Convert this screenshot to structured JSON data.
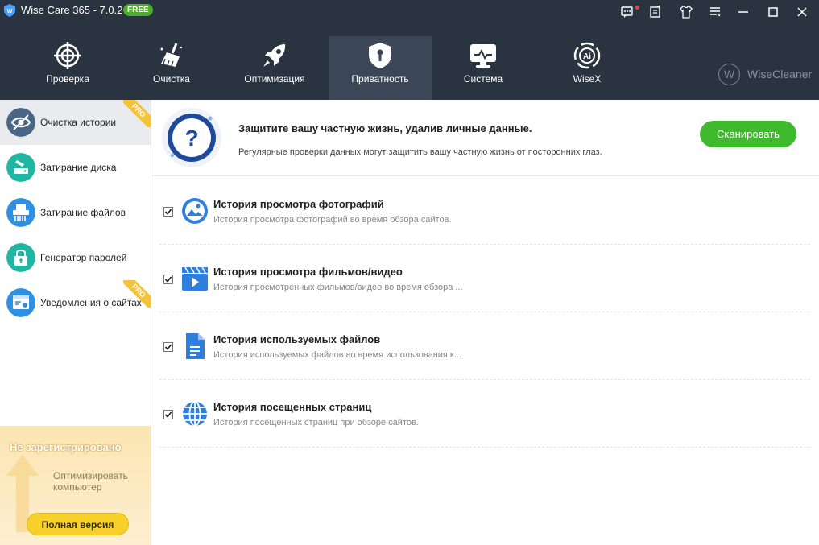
{
  "window": {
    "title": "Wise Care 365 - 7.0.2",
    "badge": "FREE"
  },
  "nav": {
    "tabs": [
      {
        "label": "Проверка",
        "icon": "crosshair-icon"
      },
      {
        "label": "Очистка",
        "icon": "broom-icon"
      },
      {
        "label": "Оптимизация",
        "icon": "rocket-icon"
      },
      {
        "label": "Приватность",
        "icon": "shield-lock-icon"
      },
      {
        "label": "Система",
        "icon": "monitor-icon"
      },
      {
        "label": "WiseX",
        "icon": "ai-icon"
      }
    ],
    "active_tab": "Приватность",
    "brand": "WiseCleaner",
    "brand_mark": "W"
  },
  "sidebar": {
    "items": [
      {
        "label": "Очистка истории",
        "badge": "PRO"
      },
      {
        "label": "Затирание диска"
      },
      {
        "label": "Затирание файлов"
      },
      {
        "label": "Генератор паролей"
      },
      {
        "label": "Уведомления о сайтах",
        "badge": "PRO"
      }
    ],
    "promo": {
      "title": "Не зарегистрировано",
      "text": "Оптимизировать компьютер",
      "button": "Полная версия"
    }
  },
  "main": {
    "banner": {
      "title": "Защитите вашу частную жизнь, удалив личные данные.",
      "subtitle": "Регулярные проверки данных могут защитить вашу частную жизнь от посторонних глаз.",
      "scan_button": "Сканировать",
      "icon": "question-icon"
    },
    "items": [
      {
        "title": "История просмотра фотографий",
        "subtitle": "История просмотра фотографий во время обзора сайтов.",
        "checked": true,
        "icon": "image-icon"
      },
      {
        "title": "История просмотра фильмов/видео",
        "subtitle": "История просмотренных фильмов/видео во время обзора ...",
        "checked": true,
        "icon": "video-icon"
      },
      {
        "title": "История используемых файлов",
        "subtitle": "История используемых файлов во время использования к...",
        "checked": true,
        "icon": "file-icon"
      },
      {
        "title": "История посещенных страниц",
        "subtitle": "История посещенных страниц при обзоре сайтов.",
        "checked": true,
        "icon": "globe-icon"
      }
    ]
  },
  "colors": {
    "header_bg": "#2a3340",
    "active_tab_bg": "#3b4756",
    "accent_green": "#3eba2c",
    "icon_blue": "#2f7fe0",
    "sidebar_teal": "#1fb7a4"
  }
}
